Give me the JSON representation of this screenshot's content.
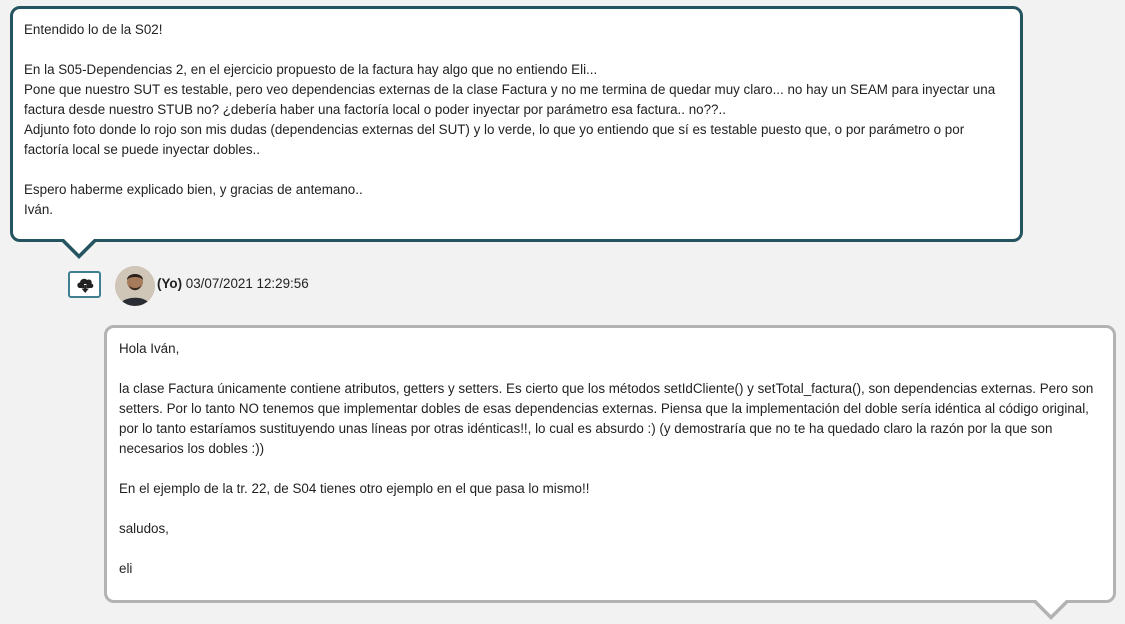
{
  "question": {
    "lines": [
      "Entendido lo de la S02!",
      "",
      "En la S05-Dependencias 2, en el ejercicio propuesto de la factura hay algo que no entiendo Eli...",
      "Pone que nuestro SUT es testable, pero veo dependencias externas de la clase Factura y no me termina de quedar muy claro... no hay un SEAM para inyectar una",
      "factura desde nuestro STUB no? ¿debería haber una factoría local o poder inyectar por parámetro esa factura.. no??..",
      "Adjunto foto donde lo rojo son mis dudas (dependencias externas del SUT) y lo verde, lo que yo entiendo que sí es testable puesto que, o por parámetro o por",
      "factoría local se puede inyectar dobles..",
      "",
      "Espero haberme explicado bien, y gracias de antemano..",
      "Iván."
    ]
  },
  "meta": {
    "author": "(Yo)",
    "timestamp": "03/07/2021 12:29:56",
    "download_icon": "cloud-download-icon"
  },
  "answer": {
    "lines": [
      "Hola Iván,",
      "",
      "la clase Factura únicamente contiene atributos, getters y setters. Es cierto que los métodos setIdCliente() y setTotal_factura(), son dependencias externas. Pero son",
      "setters. Por lo tanto NO tenemos que implementar dobles de esas dependencias externas. Piensa que la implementación del doble sería idéntica al código original,",
      "por lo tanto estaríamos sustituyendo unas líneas por otras idénticas!!, lo cual es absurdo :) (y demostraría que no te ha quedado claro la razón por la que son",
      "necesarios los dobles :))",
      "",
      "En el ejemplo de la tr. 22, de S04 tienes otro ejemplo en el que pasa lo mismo!!",
      "",
      "saludos,",
      "",
      "eli"
    ]
  },
  "colors": {
    "question_border": "#24545f",
    "answer_border": "#b3b3b3",
    "button_border": "#3f7f8f",
    "background": "#f2f2f2"
  }
}
